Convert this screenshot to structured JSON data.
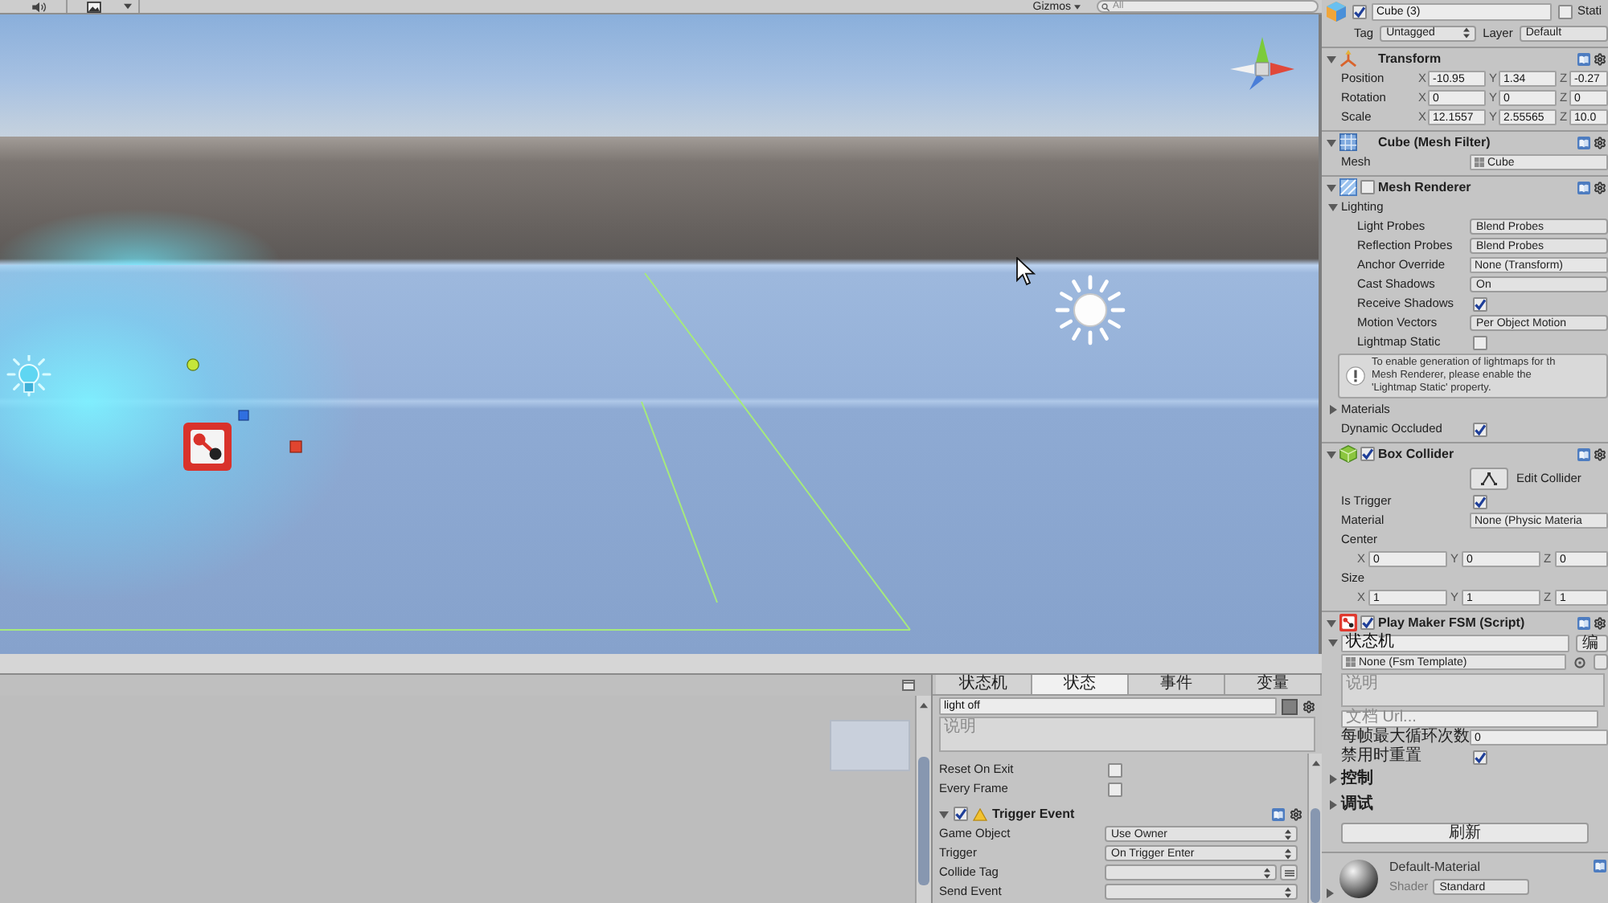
{
  "scene_toolbar": {
    "gizmos": "Gizmos",
    "search": {
      "placeholder": "All"
    }
  },
  "fsm_editor": {
    "tabs": [
      {
        "label": "状态机",
        "selected": false
      },
      {
        "label": "状态",
        "selected": true
      },
      {
        "label": "事件",
        "selected": false
      },
      {
        "label": "变量",
        "selected": false
      }
    ],
    "state_name": "light off",
    "description": {
      "placeholder": "说明"
    },
    "rows": [
      {
        "kind": "checkbox",
        "label": "Reset On Exit",
        "checked": false
      },
      {
        "kind": "checkbox",
        "label": "Every Frame",
        "checked": false
      },
      {
        "kind": "action",
        "title": "Trigger Event",
        "enabled": true,
        "expanded": true,
        "children": [
          {
            "kind": "dropdown",
            "label": "Game Object",
            "value": "Use Owner"
          },
          {
            "kind": "dropdown",
            "label": "Trigger",
            "value": "On Trigger Enter"
          },
          {
            "kind": "tag_dropdown",
            "label": "Collide Tag"
          },
          {
            "kind": "dropdown",
            "label": "Send Event"
          }
        ]
      }
    ]
  },
  "inspector": {
    "object": {
      "active": true,
      "name": "Cube (3)",
      "static": false,
      "static_label": "Stati",
      "tag_label": "Tag",
      "tag": "Untagged",
      "layer_label": "Layer",
      "layer": "Default"
    },
    "components": [
      {
        "kind": "transform",
        "title": "Transform",
        "expanded": true,
        "rows": [
          {
            "kind": "vector3",
            "label": "Position",
            "fields": [
              {
                "axis": "X",
                "value": "-10.95"
              },
              {
                "axis": "Y",
                "value": "1.34"
              },
              {
                "axis": "Z",
                "value": "-0.27"
              }
            ]
          },
          {
            "kind": "vector3",
            "label": "Rotation",
            "fields": [
              {
                "axis": "X",
                "value": "0"
              },
              {
                "axis": "Y",
                "value": "0"
              },
              {
                "axis": "Z",
                "value": "0"
              }
            ]
          },
          {
            "kind": "vector3",
            "label": "Scale",
            "fields": [
              {
                "axis": "X",
                "value": "12.1557"
              },
              {
                "axis": "Y",
                "value": "2.55565"
              },
              {
                "axis": "Z",
                "value": "10.0"
              }
            ]
          }
        ]
      },
      {
        "kind": "mesh_filter",
        "title": "Cube (Mesh Filter)",
        "expanded": true,
        "rows": [
          {
            "kind": "asset",
            "label": "Mesh",
            "value": "Cube"
          }
        ]
      },
      {
        "kind": "mesh_renderer",
        "title": "Mesh Renderer",
        "expanded": true,
        "enabled": false,
        "rows": [
          {
            "kind": "foldout",
            "label": "Lighting",
            "expanded": true,
            "children": [
              {
                "kind": "dropdown",
                "label": "Light Probes",
                "value": "Blend Probes"
              },
              {
                "kind": "dropdown",
                "label": "Reflection Probes",
                "value": "Blend Probes"
              },
              {
                "kind": "object",
                "label": "Anchor Override",
                "value": "None (Transform)"
              },
              {
                "kind": "dropdown",
                "label": "Cast Shadows",
                "value": "On"
              },
              {
                "kind": "checkbox",
                "label": "Receive Shadows",
                "checked": true
              },
              {
                "kind": "dropdown",
                "label": "Motion Vectors",
                "value": "Per Object Motion"
              },
              {
                "kind": "checkbox",
                "label": "Lightmap Static",
                "checked": false
              },
              {
                "kind": "help",
                "lines": [
                  "To enable generation of lightmaps for th",
                  "Mesh Renderer, please enable the",
                  "'Lightmap Static' property."
                ]
              }
            ]
          },
          {
            "kind": "foldout",
            "label": "Materials",
            "expanded": false
          },
          {
            "kind": "checkbox",
            "label": "Dynamic Occluded",
            "checked": true
          }
        ]
      },
      {
        "kind": "box_collider",
        "title": "Box Collider",
        "expanded": true,
        "enabled": true,
        "rows": [
          {
            "kind": "edit_button",
            "label": "Edit Collider"
          },
          {
            "kind": "checkbox",
            "label": "Is Trigger",
            "checked": true
          },
          {
            "kind": "object",
            "label": "Material",
            "value": "None (Physic Materia"
          },
          {
            "kind": "vector3_block",
            "label": "Center",
            "fields": [
              {
                "axis": "X",
                "value": "0"
              },
              {
                "axis": "Y",
                "value": "0"
              },
              {
                "axis": "Z",
                "value": "0"
              }
            ]
          },
          {
            "kind": "vector3_block",
            "label": "Size",
            "fields": [
              {
                "axis": "X",
                "value": "1"
              },
              {
                "axis": "Y",
                "value": "1"
              },
              {
                "axis": "Z",
                "value": "1"
              }
            ]
          }
        ]
      },
      {
        "kind": "playmaker_fsm",
        "title": "Play Maker FSM (Script)",
        "expanded": true,
        "enabled": true,
        "rows": [
          {
            "kind": "fsm_name",
            "expanded": true,
            "value": "状态机",
            "button": "编"
          },
          {
            "kind": "template",
            "value": "None (Fsm Template)"
          },
          {
            "kind": "textarea",
            "placeholder": "说明"
          },
          {
            "kind": "text",
            "placeholder": "文档 Url..."
          },
          {
            "kind": "number",
            "label": "每帧最大循环次数",
            "value": "0"
          },
          {
            "kind": "checkbox",
            "label": "禁用时重置",
            "checked": true
          },
          {
            "kind": "foldout",
            "label": "控制",
            "expanded": false
          },
          {
            "kind": "foldout",
            "label": "调试",
            "expanded": false
          },
          {
            "kind": "button",
            "label": "刷新"
          }
        ]
      }
    ],
    "material": {
      "name": "Default-Material",
      "shader_label": "Shader",
      "shader": "Standard",
      "expanded": false
    }
  }
}
